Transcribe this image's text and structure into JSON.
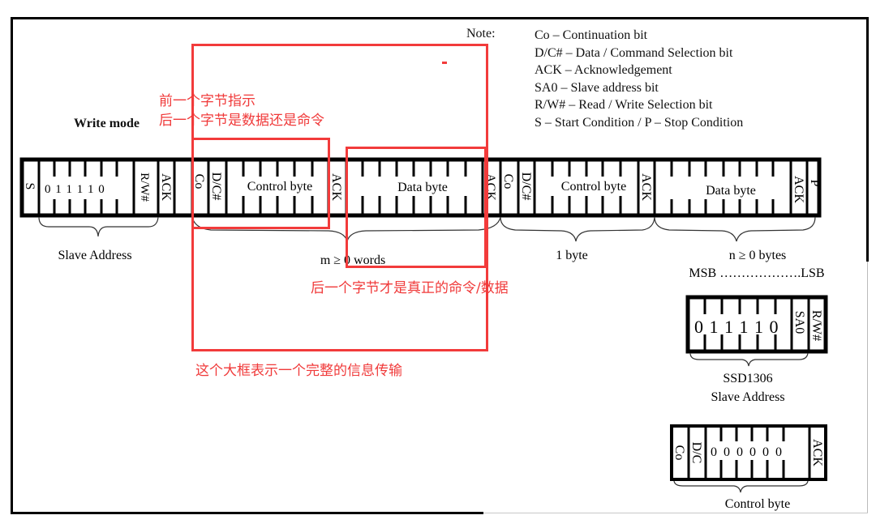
{
  "note": {
    "label": "Note:",
    "items": [
      "Co – Continuation bit",
      "D/C# – Data / Command Selection bit",
      "ACK – Acknowledgement",
      "SA0 – Slave address bit",
      "R/W# – Read / Write Selection bit",
      "S – Start Condition / P – Stop Condition"
    ]
  },
  "mode_label": "Write mode",
  "annotations": {
    "prev_byte_line1": "前一个字节指示",
    "prev_byte_line2": "后一个字节是数据还是命令",
    "next_byte": "后一个字节才是真正的命令/数据",
    "big_box": "这个大框表示一个完整的信息传输"
  },
  "main_frame": {
    "cells": {
      "start": "S",
      "address_bits": "0 1 1 1 1 0",
      "rw": "R/W#",
      "ack1": "ACK",
      "co1": "Co",
      "dc1": "D/C#",
      "control_byte1": "Control byte",
      "ack2": "ACK",
      "data_byte1": "Data byte",
      "ack3": "ACK",
      "co2": "Co",
      "dc2": "D/C#",
      "control_byte2": "Control byte",
      "ack4": "ACK",
      "data_byte2": "Data byte",
      "ack5": "ACK",
      "stop": "P"
    },
    "braces": {
      "slave_address": "Slave Address",
      "m_words": "m ≥ 0 words",
      "one_byte": "1 byte",
      "n_bytes": "n ≥ 0 bytes",
      "msb_lsb": "MSB ……………….LSB"
    }
  },
  "ssd1306_address": {
    "bits": "0 1 1 1 1 0",
    "sa0": "SA0",
    "rw": "R/W#",
    "caption_line1": "SSD1306",
    "caption_line2": "Slave Address"
  },
  "control_byte_detail": {
    "co": "Co",
    "dc": "D/C",
    "bits": "0 0 0 0 0 0",
    "ack": "ACK",
    "caption": "Control byte"
  }
}
